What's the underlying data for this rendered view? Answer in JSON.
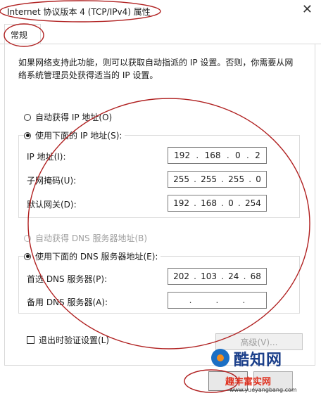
{
  "window": {
    "title": "Internet 协议版本 4 (TCP/IPv4) 属性",
    "close_glyph": "✕"
  },
  "tabs": [
    {
      "label": "常规",
      "selected": true
    }
  ],
  "description": "如果网络支持此功能，则可以获取自动指派的 IP 设置。否则，你需要从网络系统管理员处获得适当的 IP 设置。",
  "ip_mode": {
    "auto_label": "自动获得 IP 地址(O)",
    "manual_label": "使用下面的 IP 地址(S):",
    "selected": "manual"
  },
  "ip_fields": [
    {
      "label": "IP 地址(I):",
      "octets": [
        "192",
        "168",
        "0",
        "2"
      ]
    },
    {
      "label": "子网掩码(U):",
      "octets": [
        "255",
        "255",
        "255",
        "0"
      ]
    },
    {
      "label": "默认网关(D):",
      "octets": [
        "192",
        "168",
        "0",
        "254"
      ]
    }
  ],
  "dns_mode": {
    "auto_label": "自动获得 DNS 服务器地址(B)",
    "manual_label": "使用下面的 DNS 服务器地址(E):",
    "selected": "manual",
    "auto_disabled": true
  },
  "dns_fields": [
    {
      "label": "首选 DNS 服务器(P):",
      "octets": [
        "202",
        "103",
        "24",
        "68"
      ]
    },
    {
      "label": "备用 DNS 服务器(A):",
      "octets": [
        "",
        "",
        "",
        ""
      ]
    }
  ],
  "validate": {
    "label": "退出时验证设置(L)",
    "checked": false
  },
  "buttons": {
    "advanced_label": "高级(V)..."
  },
  "watermark": {
    "brand": "酷知网",
    "slogan": "趣丰富实网",
    "url": "www.yueyangbang.com"
  },
  "colors": {
    "annotation": "#b02020",
    "border": "#d9d9d9"
  },
  "icons": {
    "close": "close-icon"
  }
}
